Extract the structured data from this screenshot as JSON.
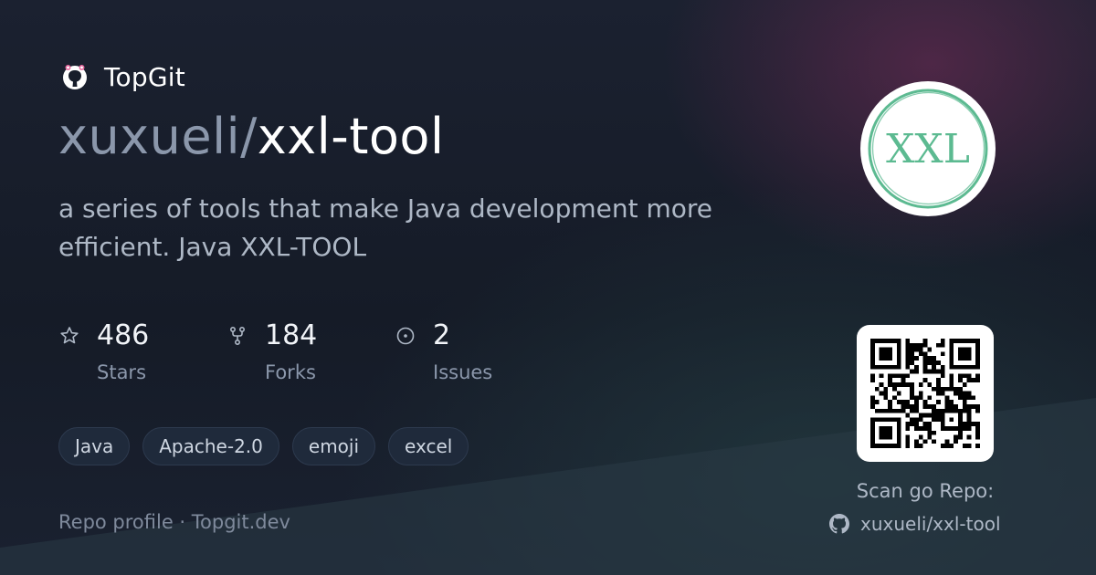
{
  "brand": {
    "name": "TopGit",
    "icon": "github-octocat-icon"
  },
  "repo": {
    "owner": "xuxueli",
    "separator": "/",
    "name": "xxl-tool"
  },
  "description": "a series of tools that make Java development more efficient. Java XXL-TOOL",
  "stats": [
    {
      "icon": "star-icon",
      "value": "486",
      "label": "Stars"
    },
    {
      "icon": "fork-icon",
      "value": "184",
      "label": "Forks"
    },
    {
      "icon": "issue-icon",
      "value": "2",
      "label": "Issues"
    }
  ],
  "tags": [
    "Java",
    "Apache-2.0",
    "emoji",
    "excel"
  ],
  "footer": "Repo profile · Topgit.dev",
  "logo": {
    "text": "XXL",
    "color": "#5cba91"
  },
  "qr": {
    "label": "Scan go Repo:",
    "repo": "xuxueli/xxl-tool",
    "icon": "github-icon"
  },
  "colors": {
    "background": "#171d2a",
    "accent_green": "#5cba91",
    "muted": "#8b97ab"
  }
}
